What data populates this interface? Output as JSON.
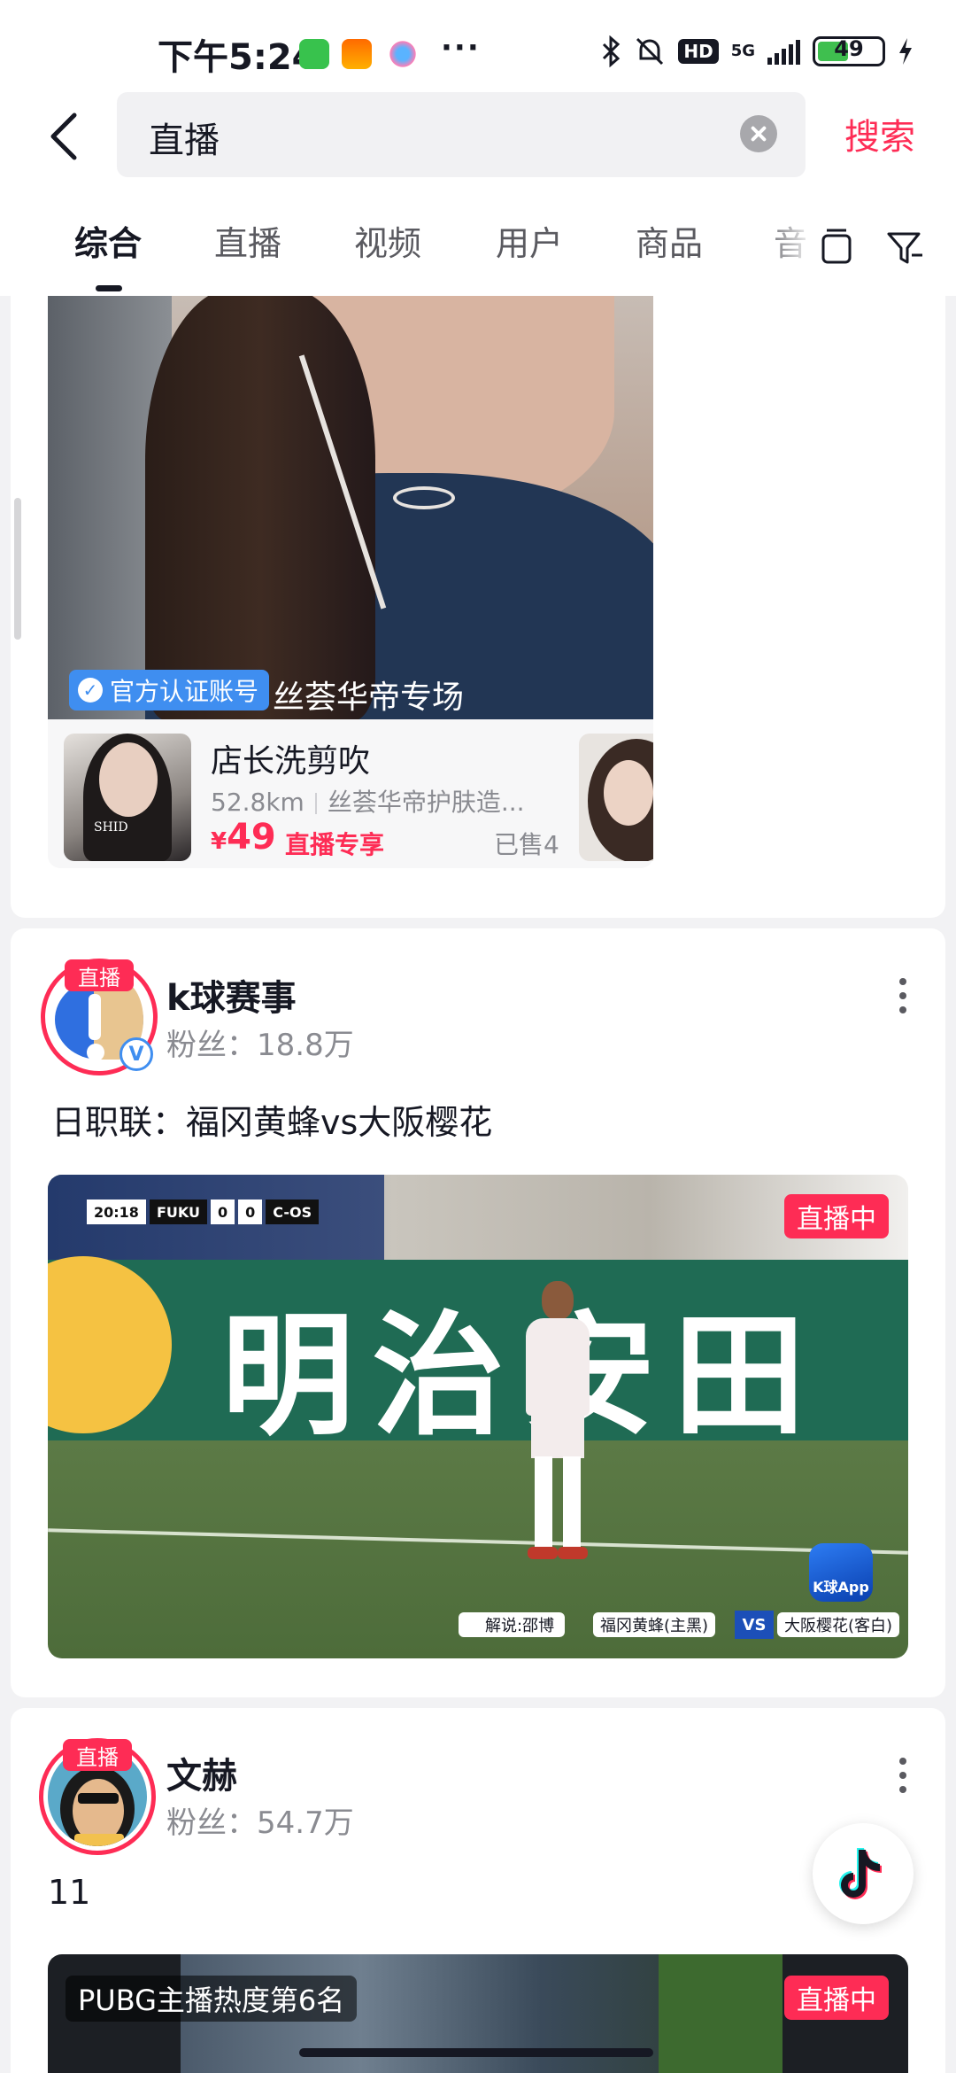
{
  "status_bar": {
    "time": "下午5:24",
    "network": "5G",
    "hd": "HD",
    "battery": "49",
    "battery_level": 0.49
  },
  "search": {
    "query": "直播",
    "submit_label": "搜索"
  },
  "tabs": [
    {
      "label": "综合",
      "active": true
    },
    {
      "label": "直播",
      "active": false
    },
    {
      "label": "视频",
      "active": false
    },
    {
      "label": "用户",
      "active": false
    },
    {
      "label": "商品",
      "active": false
    },
    {
      "label": "音",
      "active": false
    }
  ],
  "shop_card": {
    "verified_label": "官方认证账号",
    "shop_name": "丝荟华帝专场",
    "product": {
      "thumb_text": "SHID",
      "title": "店长洗剪吹",
      "distance": "52.8km",
      "store": "丝荟华帝护肤造...",
      "currency": "¥",
      "price": "49",
      "promo": "直播专享",
      "sold": "已售4"
    }
  },
  "live_cards": [
    {
      "live_badge": "直播",
      "author": "k球赛事",
      "fans": "粉丝：18.8万",
      "description": "日职联：福冈黄蜂vs大阪樱花",
      "status": "直播中",
      "scoreboard": {
        "clock": "20:18",
        "home": "FUKU",
        "home_score": "0",
        "away_score": "0",
        "away": "C-OS"
      },
      "banner_text": "明治安田",
      "commentary": "解说:邵博",
      "home_team": "福冈黄蜂(主黑)",
      "vs": "VS",
      "away_team": "大阪樱花(客白)",
      "watermark": "K球App"
    },
    {
      "live_badge": "直播",
      "author": "文赫",
      "fans": "粉丝：54.7万",
      "description": "11",
      "status": "直播中",
      "rank_text": "PUBG主播热度第6名"
    }
  ],
  "colors": {
    "accent": "#fe2c55",
    "verified_blue": "#3f8ef0",
    "text_primary": "#161823",
    "text_secondary": "#8a8b91"
  },
  "icons": [
    "back-arrow-icon",
    "clear-icon",
    "duplicate-icon",
    "filter-icon",
    "more-icon",
    "douyin-logo-icon"
  ]
}
